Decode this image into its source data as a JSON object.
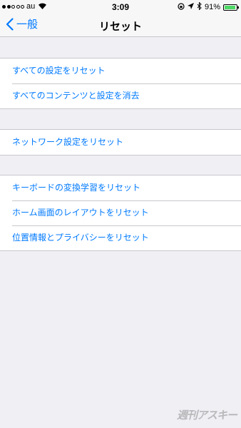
{
  "status_bar": {
    "carrier": "au",
    "time": "3:09",
    "battery_percent": "91%",
    "battery_level": 0.91,
    "signal_strength": 2,
    "battery_color": "#4cd964"
  },
  "nav": {
    "back_label": "一般",
    "title": "リセット",
    "accent_color": "#007aff"
  },
  "groups": [
    {
      "items": [
        {
          "label": "すべての設定をリセット"
        },
        {
          "label": "すべてのコンテンツと設定を消去"
        }
      ]
    },
    {
      "items": [
        {
          "label": "ネットワーク設定をリセット"
        }
      ]
    },
    {
      "items": [
        {
          "label": "キーボードの変換学習をリセット"
        },
        {
          "label": "ホーム画面のレイアウトをリセット"
        },
        {
          "label": "位置情報とプライバシーをリセット"
        }
      ]
    }
  ],
  "watermark": "週刊アスキー"
}
